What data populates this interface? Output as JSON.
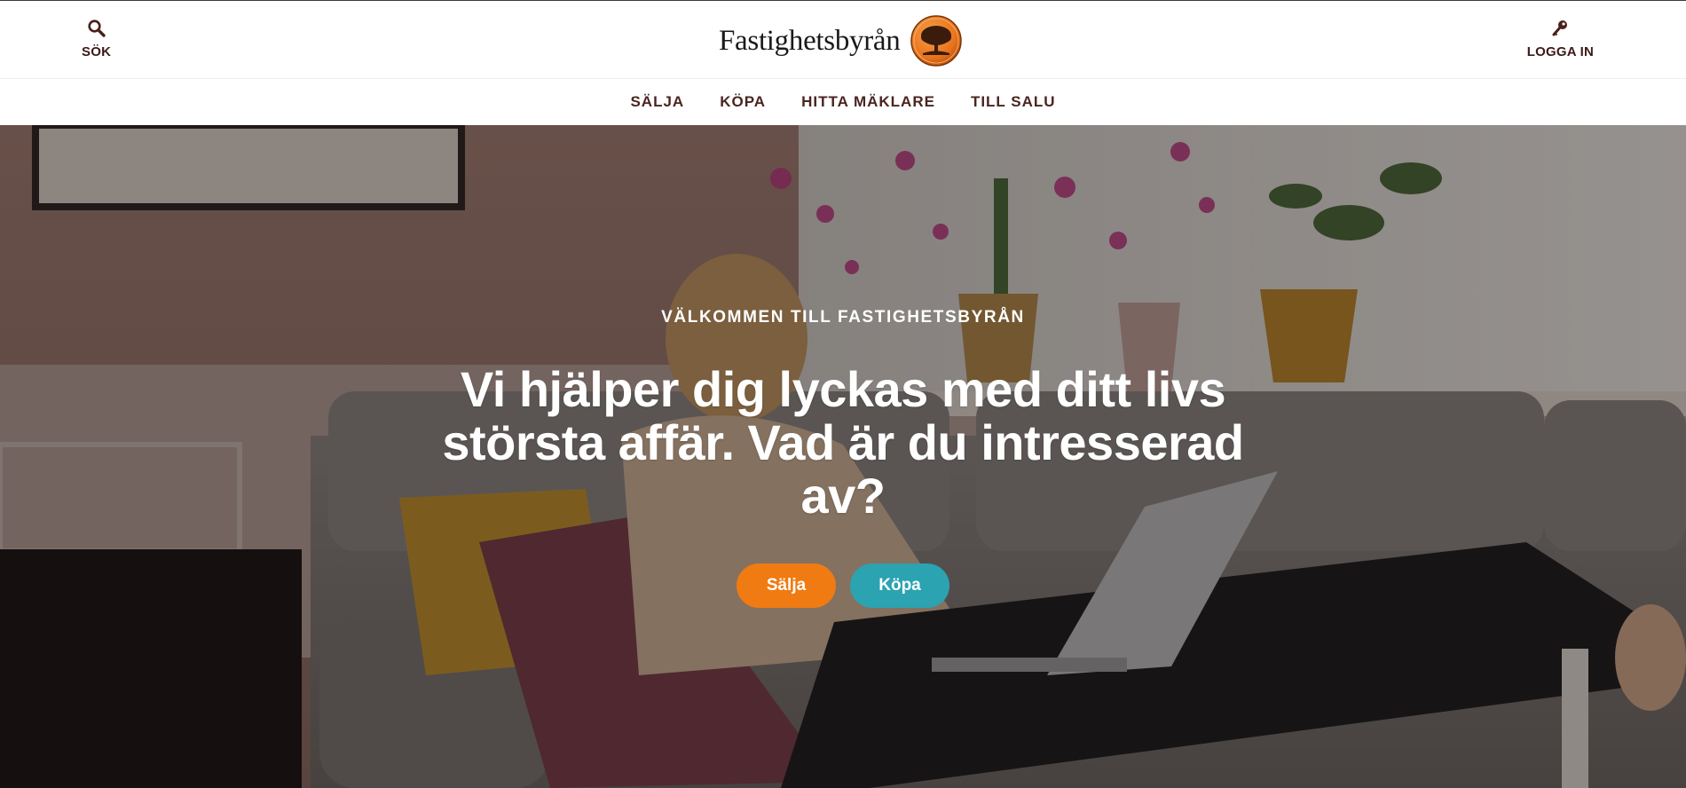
{
  "header": {
    "search_label": "SÖK",
    "login_label": "LOGGA IN",
    "brand_name": "Fastighetsbyrån",
    "icons": {
      "search": "search-icon",
      "login": "key-icon",
      "logo": "tree-emblem-logo"
    }
  },
  "nav": {
    "items": [
      {
        "label": "SÄLJA"
      },
      {
        "label": "KÖPA"
      },
      {
        "label": "HITTA MÄKLARE"
      },
      {
        "label": "TILL SALU"
      }
    ]
  },
  "hero": {
    "eyebrow": "VÄLKOMMEN TILL FASTIGHETSBYRÅN",
    "headline": "Vi hjälper dig lyckas med ditt livs största affär. Vad är du intresserad av?",
    "cta_sell": {
      "label": "Sälja",
      "color": "#f07b12"
    },
    "cta_buy": {
      "label": "Köpa",
      "color": "#2ba3b0"
    }
  },
  "colors": {
    "text_dark": "#4a2420",
    "logo_orange": "#e8731c"
  }
}
